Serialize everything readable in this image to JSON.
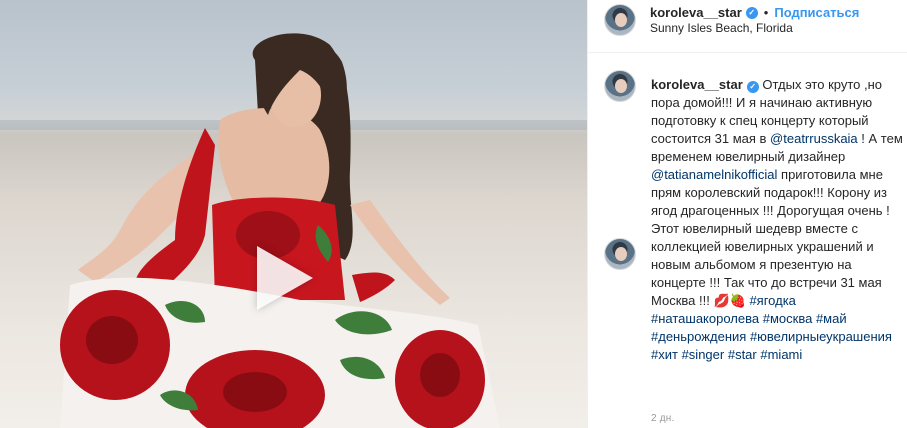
{
  "post": {
    "username": "koroleva__star",
    "verified_glyph": "✓",
    "separator": "•",
    "follow_label": "Подписаться",
    "location": "Sunny Isles Beach, Florida",
    "caption": {
      "username": "koroleva__star",
      "segments": [
        {
          "type": "text",
          "value": " Отдых это круто ,но пора домой!!! И я начинаю активную подготовку к спец концерту который состоится 31 мая в "
        },
        {
          "type": "mention",
          "value": "@teatrrusskaia"
        },
        {
          "type": "text",
          "value": " ! А тем временем ювелирный дизайнер "
        },
        {
          "type": "mention",
          "value": "@tatianamelnikofficial"
        },
        {
          "type": "text",
          "value": " приготовила мне прям королевский подарок!!! Корону из ягод драгоценных !!! Дорогущая очень ! Этот ювелирный шедевр вместе с коллекцией ювелирных украшений и новым альбомом я презентую на концерте !!! Так что до встречи 31 мая Москва !!! 💋🍓 "
        },
        {
          "type": "tag",
          "value": "#ягодка"
        },
        {
          "type": "text",
          "value": " "
        },
        {
          "type": "tag",
          "value": "#наташакоролева"
        },
        {
          "type": "text",
          "value": " "
        },
        {
          "type": "tag",
          "value": "#москва"
        },
        {
          "type": "text",
          "value": " "
        },
        {
          "type": "tag",
          "value": "#май"
        },
        {
          "type": "text",
          "value": " "
        },
        {
          "type": "tag",
          "value": "#деньрождения"
        },
        {
          "type": "text",
          "value": " "
        },
        {
          "type": "tag",
          "value": "#ювелирныеукрашения"
        },
        {
          "type": "text",
          "value": " "
        },
        {
          "type": "tag",
          "value": "#хит"
        },
        {
          "type": "text",
          "value": " "
        },
        {
          "type": "tag",
          "value": "#singer"
        },
        {
          "type": "text",
          "value": " "
        },
        {
          "type": "tag",
          "value": "#star"
        },
        {
          "type": "text",
          "value": " "
        },
        {
          "type": "tag",
          "value": "#miami"
        }
      ]
    },
    "timestamp": "2 дн."
  },
  "colors": {
    "link": "#003569",
    "accent": "#3897f0",
    "dress_red": "#c0141c",
    "muted": "#999999"
  },
  "icons": {
    "verified": "verified-badge-icon",
    "play": "play-icon"
  }
}
